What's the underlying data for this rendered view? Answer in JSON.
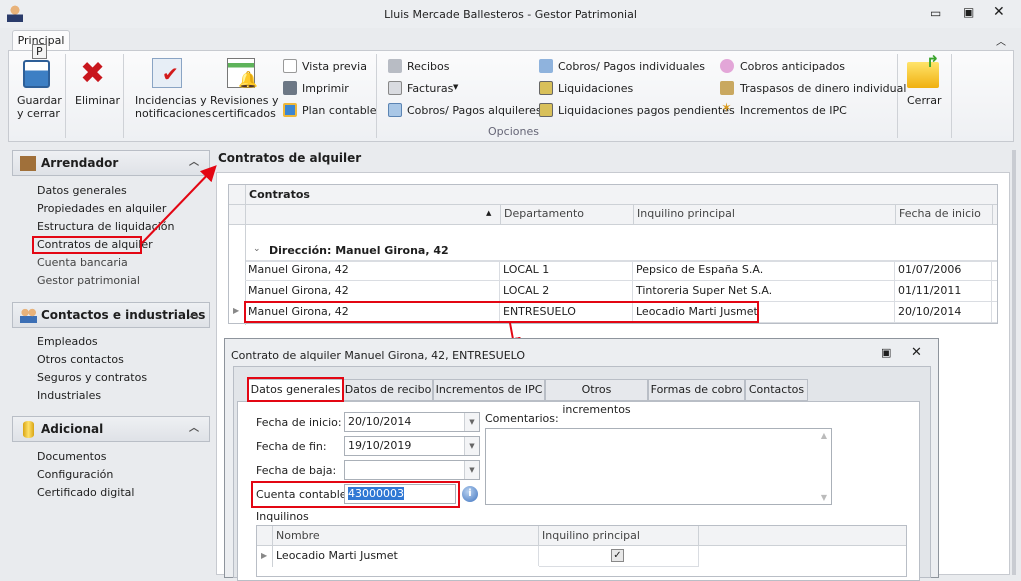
{
  "window": {
    "title": "Lluis Mercade Ballesteros - Gestor Patrimonial"
  },
  "ribbon": {
    "tab": "Principal",
    "key_tip": "P",
    "buttons": {
      "save": [
        "Guardar",
        "y cerrar"
      ],
      "delete": "Eliminar",
      "incidents": [
        "Incidencias y",
        "notificaciones"
      ],
      "reviews": [
        "Revisiones y",
        "certificados"
      ],
      "close": "Cerrar"
    },
    "small": {
      "preview": "Vista previa",
      "print": "Imprimir",
      "chart": "Plan contable",
      "receipts": "Recibos",
      "invoices": "Facturas",
      "rent_payments": "Cobros/ Pagos alquileres",
      "individual_payments": "Cobros/ Pagos individuales",
      "settlements": "Liquidaciones",
      "pending_settlements": "Liquidaciones pagos pendientes",
      "advance": "Cobros anticipados",
      "transfers": "Traspasos de dinero individual",
      "ipc": "Incrementos de IPC"
    },
    "group_label": "Opciones"
  },
  "sidebar": {
    "groups": [
      {
        "title": "Arrendador",
        "items": [
          "Datos generales",
          "Propiedades en alquiler",
          "Estructura de liquidación",
          "Contratos de alquiler",
          "Cuenta bancaria",
          "Gestor patrimonial"
        ]
      },
      {
        "title": "Contactos e industriales",
        "items": [
          "Empleados",
          "Otros contactos",
          "Seguros y contratos",
          "Industriales"
        ]
      },
      {
        "title": "Adicional",
        "items": [
          "Documentos",
          "Configuración",
          "Certificado digital"
        ]
      }
    ]
  },
  "main": {
    "title": "Contratos de alquiler",
    "grid": {
      "caption": "Contratos",
      "columns": [
        "",
        "Departamento",
        "Inquilino principal",
        "Fecha de inicio"
      ],
      "group": "Dirección: Manuel Girona, 42",
      "rows": [
        [
          "Manuel Girona, 42",
          "LOCAL 1",
          "Pepsico de España S.A.",
          "01/07/2006"
        ],
        [
          "Manuel Girona, 42",
          "LOCAL 2",
          "Tintoreria Super Net S.A.",
          "01/11/2011"
        ],
        [
          "Manuel Girona, 42",
          "ENTRESUELO",
          "Leocadio Marti Jusmet",
          "20/10/2014"
        ]
      ]
    }
  },
  "dialog": {
    "title": "Contrato de alquiler Manuel Girona, 42, ENTRESUELO",
    "tabs": [
      "Datos generales",
      "Datos de recibo",
      "Incrementos de IPC",
      "Otros incrementos",
      "Formas de cobro",
      "Contactos"
    ],
    "fields": {
      "start_label": "Fecha de inicio:",
      "start": "20/10/2014",
      "end_label": "Fecha de fin:",
      "end": "19/10/2019",
      "cancel_label": "Fecha de baja:",
      "cancel": "",
      "account_label": "Cuenta contable:",
      "account": "43000003",
      "comments_label": "Comentarios:"
    },
    "tenants": {
      "label": "Inquilinos",
      "columns": [
        "Nombre",
        "Inquilino principal"
      ],
      "rows": [
        {
          "name": "Leocadio Marti Jusmet",
          "principal": true
        }
      ]
    }
  },
  "colors": {
    "highlight": "#e30613",
    "selection": "#3078d4"
  }
}
